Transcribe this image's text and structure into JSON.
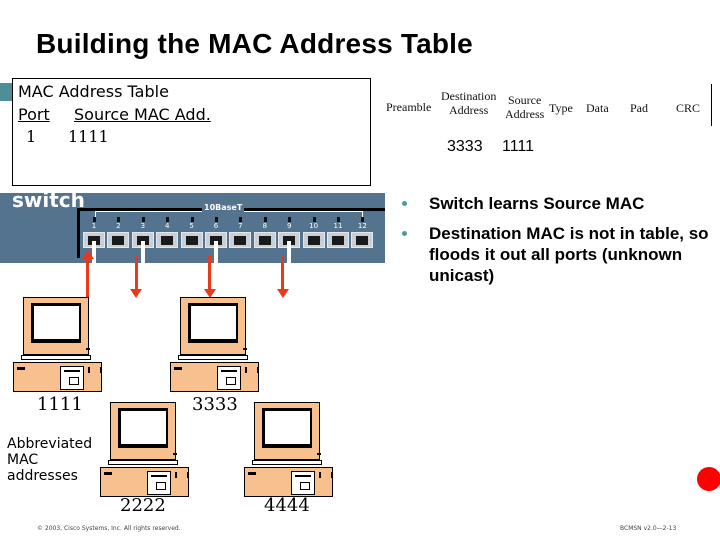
{
  "slide": {
    "title": "Building the MAC Address Table",
    "accent_color": "#4e8e98"
  },
  "mac_table": {
    "title": "MAC Address Table",
    "headers": {
      "port": "Port",
      "mac": "Source MAC Add."
    },
    "rows": [
      {
        "port": "1",
        "mac": "1111"
      }
    ]
  },
  "frame": {
    "fields": [
      {
        "name": "preamble",
        "label": "Preamble"
      },
      {
        "name": "destination",
        "label_line1": "Destination",
        "label_line2": "Address"
      },
      {
        "name": "source",
        "label_line1": "Source",
        "label_line2": "Address"
      },
      {
        "name": "type",
        "label": "Type"
      },
      {
        "name": "data",
        "label": "Data"
      },
      {
        "name": "pad",
        "label": "Pad"
      },
      {
        "name": "crc",
        "label": "CRC"
      }
    ],
    "destination_value": "3333",
    "source_value": "1111"
  },
  "switch": {
    "label": "switch",
    "bracket_label": "10BaseT",
    "ports": [
      "1",
      "2",
      "3",
      "4",
      "5",
      "6",
      "7",
      "8",
      "9",
      "10",
      "11",
      "12"
    ],
    "body_color": "#54738e",
    "arrow_color": "#e8391a"
  },
  "bullets": [
    "Switch learns Source MAC",
    "Destination MAC is not in table, so floods it out all ports (unknown unicast)"
  ],
  "hosts": [
    {
      "mac": "1111",
      "port": "1",
      "direction": "inbound"
    },
    {
      "mac": "2222",
      "port": "3",
      "direction": "outbound"
    },
    {
      "mac": "3333",
      "port": "6",
      "direction": "outbound"
    },
    {
      "mac": "4444",
      "port": "9",
      "direction": "outbound"
    }
  ],
  "note": {
    "line1": "Abbreviated",
    "line2": "MAC",
    "line3": "addresses"
  },
  "footer": {
    "copyright": "© 2003, Cisco Systems, Inc. All rights reserved.",
    "course": "BCMSN v2.0—2-13"
  }
}
